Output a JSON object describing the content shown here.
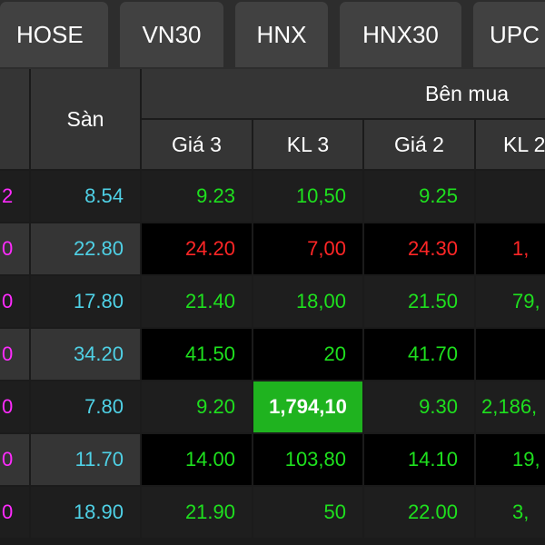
{
  "tabs": [
    "HOSE",
    "VN30",
    "HNX",
    "HNX30",
    "UPC"
  ],
  "header": {
    "san": "Sàn",
    "ben_mua": "Bên mua",
    "cols": [
      "Giá 3",
      "KL 3",
      "Giá 2",
      "KL 2"
    ]
  },
  "rows": [
    {
      "prev": "2",
      "san": "8.54",
      "gia3": "9.23",
      "kl3": "10,50",
      "gia2": "9.25",
      "kl2": "",
      "gia3_color": "green",
      "kl3_color": "green",
      "gia2_color": "green",
      "kl2_color": "green"
    },
    {
      "prev": "0",
      "san": "22.80",
      "gia3": "24.20",
      "kl3": "7,00",
      "gia2": "24.30",
      "kl2": "1,",
      "gia3_color": "red",
      "kl3_color": "red",
      "gia2_color": "red",
      "kl2_color": "red"
    },
    {
      "prev": "0",
      "san": "17.80",
      "gia3": "21.40",
      "kl3": "18,00",
      "gia2": "21.50",
      "kl2": "79,",
      "gia3_color": "green",
      "kl3_color": "green",
      "gia2_color": "green",
      "kl2_color": "green"
    },
    {
      "prev": "0",
      "san": "34.20",
      "gia3": "41.50",
      "kl3": "20",
      "gia2": "41.70",
      "kl2": "",
      "gia3_color": "green",
      "kl3_color": "green",
      "gia2_color": "green",
      "kl2_color": "green"
    },
    {
      "prev": "0",
      "san": "7.80",
      "gia3": "9.20",
      "kl3": "1,794,10",
      "gia2": "9.30",
      "kl2": "2,186,",
      "gia3_color": "green",
      "kl3_color": "green",
      "gia2_color": "green",
      "kl2_color": "green",
      "kl3_highlight": true
    },
    {
      "prev": "0",
      "san": "11.70",
      "gia3": "14.00",
      "kl3": "103,80",
      "gia2": "14.10",
      "kl2": "19,",
      "gia3_color": "green",
      "kl3_color": "green",
      "gia2_color": "green",
      "kl2_color": "green"
    },
    {
      "prev": "0",
      "san": "18.90",
      "gia3": "21.90",
      "kl3": "50",
      "gia2": "22.00",
      "kl2": "3,",
      "gia3_color": "green",
      "kl3_color": "green",
      "gia2_color": "green",
      "kl2_color": "green"
    }
  ],
  "colors": {
    "green": "#1ee01e",
    "red": "#ff2626",
    "floor_cyan": "#4fd1e6",
    "ceiling_magenta": "#ff2bff",
    "highlight_green": "#1fb31f"
  }
}
